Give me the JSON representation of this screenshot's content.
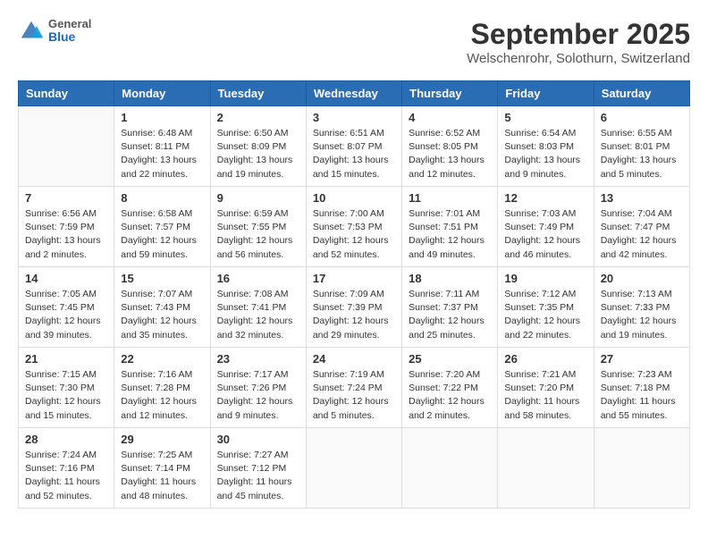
{
  "header": {
    "logo": {
      "general": "General",
      "blue": "Blue"
    },
    "month": "September 2025",
    "location": "Welschenrohr, Solothurn, Switzerland"
  },
  "weekdays": [
    "Sunday",
    "Monday",
    "Tuesday",
    "Wednesday",
    "Thursday",
    "Friday",
    "Saturday"
  ],
  "weeks": [
    [
      {
        "day": "",
        "info": ""
      },
      {
        "day": "1",
        "info": "Sunrise: 6:48 AM\nSunset: 8:11 PM\nDaylight: 13 hours\nand 22 minutes."
      },
      {
        "day": "2",
        "info": "Sunrise: 6:50 AM\nSunset: 8:09 PM\nDaylight: 13 hours\nand 19 minutes."
      },
      {
        "day": "3",
        "info": "Sunrise: 6:51 AM\nSunset: 8:07 PM\nDaylight: 13 hours\nand 15 minutes."
      },
      {
        "day": "4",
        "info": "Sunrise: 6:52 AM\nSunset: 8:05 PM\nDaylight: 13 hours\nand 12 minutes."
      },
      {
        "day": "5",
        "info": "Sunrise: 6:54 AM\nSunset: 8:03 PM\nDaylight: 13 hours\nand 9 minutes."
      },
      {
        "day": "6",
        "info": "Sunrise: 6:55 AM\nSunset: 8:01 PM\nDaylight: 13 hours\nand 5 minutes."
      }
    ],
    [
      {
        "day": "7",
        "info": "Sunrise: 6:56 AM\nSunset: 7:59 PM\nDaylight: 13 hours\nand 2 minutes."
      },
      {
        "day": "8",
        "info": "Sunrise: 6:58 AM\nSunset: 7:57 PM\nDaylight: 12 hours\nand 59 minutes."
      },
      {
        "day": "9",
        "info": "Sunrise: 6:59 AM\nSunset: 7:55 PM\nDaylight: 12 hours\nand 56 minutes."
      },
      {
        "day": "10",
        "info": "Sunrise: 7:00 AM\nSunset: 7:53 PM\nDaylight: 12 hours\nand 52 minutes."
      },
      {
        "day": "11",
        "info": "Sunrise: 7:01 AM\nSunset: 7:51 PM\nDaylight: 12 hours\nand 49 minutes."
      },
      {
        "day": "12",
        "info": "Sunrise: 7:03 AM\nSunset: 7:49 PM\nDaylight: 12 hours\nand 46 minutes."
      },
      {
        "day": "13",
        "info": "Sunrise: 7:04 AM\nSunset: 7:47 PM\nDaylight: 12 hours\nand 42 minutes."
      }
    ],
    [
      {
        "day": "14",
        "info": "Sunrise: 7:05 AM\nSunset: 7:45 PM\nDaylight: 12 hours\nand 39 minutes."
      },
      {
        "day": "15",
        "info": "Sunrise: 7:07 AM\nSunset: 7:43 PM\nDaylight: 12 hours\nand 35 minutes."
      },
      {
        "day": "16",
        "info": "Sunrise: 7:08 AM\nSunset: 7:41 PM\nDaylight: 12 hours\nand 32 minutes."
      },
      {
        "day": "17",
        "info": "Sunrise: 7:09 AM\nSunset: 7:39 PM\nDaylight: 12 hours\nand 29 minutes."
      },
      {
        "day": "18",
        "info": "Sunrise: 7:11 AM\nSunset: 7:37 PM\nDaylight: 12 hours\nand 25 minutes."
      },
      {
        "day": "19",
        "info": "Sunrise: 7:12 AM\nSunset: 7:35 PM\nDaylight: 12 hours\nand 22 minutes."
      },
      {
        "day": "20",
        "info": "Sunrise: 7:13 AM\nSunset: 7:33 PM\nDaylight: 12 hours\nand 19 minutes."
      }
    ],
    [
      {
        "day": "21",
        "info": "Sunrise: 7:15 AM\nSunset: 7:30 PM\nDaylight: 12 hours\nand 15 minutes."
      },
      {
        "day": "22",
        "info": "Sunrise: 7:16 AM\nSunset: 7:28 PM\nDaylight: 12 hours\nand 12 minutes."
      },
      {
        "day": "23",
        "info": "Sunrise: 7:17 AM\nSunset: 7:26 PM\nDaylight: 12 hours\nand 9 minutes."
      },
      {
        "day": "24",
        "info": "Sunrise: 7:19 AM\nSunset: 7:24 PM\nDaylight: 12 hours\nand 5 minutes."
      },
      {
        "day": "25",
        "info": "Sunrise: 7:20 AM\nSunset: 7:22 PM\nDaylight: 12 hours\nand 2 minutes."
      },
      {
        "day": "26",
        "info": "Sunrise: 7:21 AM\nSunset: 7:20 PM\nDaylight: 11 hours\nand 58 minutes."
      },
      {
        "day": "27",
        "info": "Sunrise: 7:23 AM\nSunset: 7:18 PM\nDaylight: 11 hours\nand 55 minutes."
      }
    ],
    [
      {
        "day": "28",
        "info": "Sunrise: 7:24 AM\nSunset: 7:16 PM\nDaylight: 11 hours\nand 52 minutes."
      },
      {
        "day": "29",
        "info": "Sunrise: 7:25 AM\nSunset: 7:14 PM\nDaylight: 11 hours\nand 48 minutes."
      },
      {
        "day": "30",
        "info": "Sunrise: 7:27 AM\nSunset: 7:12 PM\nDaylight: 11 hours\nand 45 minutes."
      },
      {
        "day": "",
        "info": ""
      },
      {
        "day": "",
        "info": ""
      },
      {
        "day": "",
        "info": ""
      },
      {
        "day": "",
        "info": ""
      }
    ]
  ]
}
